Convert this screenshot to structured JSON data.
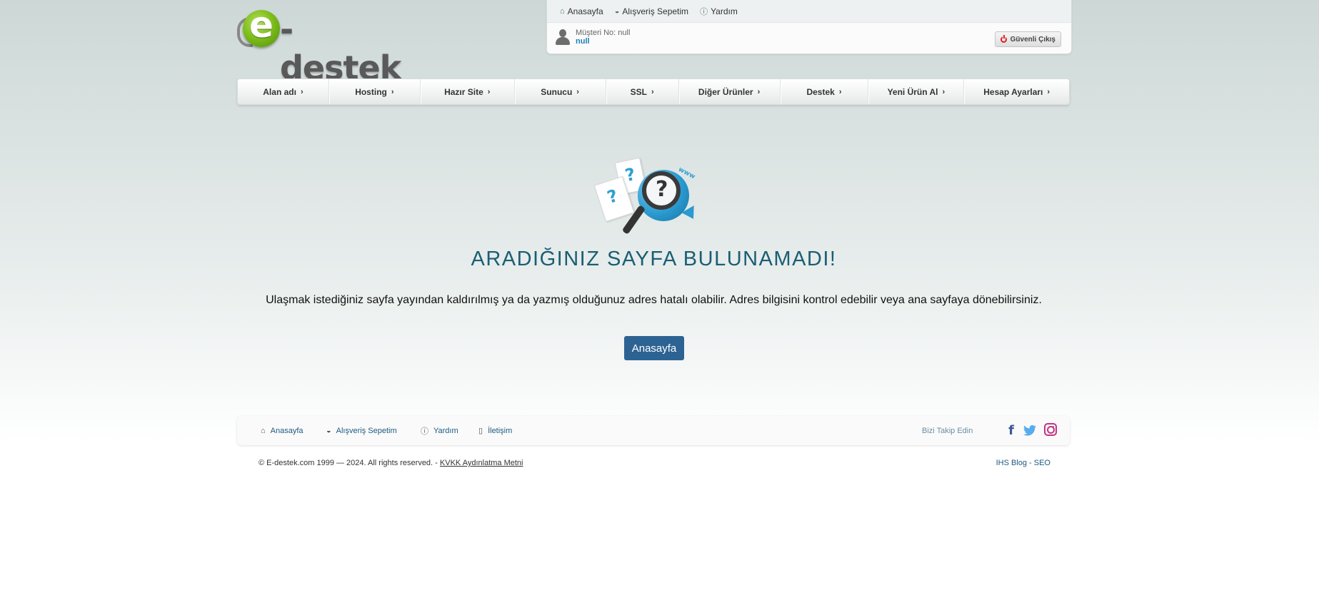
{
  "brand": {
    "logo_text": "e-destek"
  },
  "top_links": [
    {
      "label": "Anasayfa",
      "icon": "home-icon"
    },
    {
      "label": "Alışveriş Sepetim",
      "icon": "basket-icon"
    },
    {
      "label": "Yardım",
      "icon": "help-icon"
    }
  ],
  "customer": {
    "number_label": "Müşteri No: null",
    "name": "null"
  },
  "logout_label": "Güvenli Çıkış",
  "nav": [
    {
      "label": "Alan adı"
    },
    {
      "label": "Hosting"
    },
    {
      "label": "Hazır Site"
    },
    {
      "label": "Sunucu"
    },
    {
      "label": "SSL"
    },
    {
      "label": "Diğer Ürünler"
    },
    {
      "label": "Destek"
    },
    {
      "label": "Yeni Ürün Al"
    },
    {
      "label": "Hesap Ayarları"
    }
  ],
  "error": {
    "title": "ARADIĞINIZ SAYFA BULUNAMADI!",
    "message": "Ulaşmak istediğiniz sayfa yayından kaldırılmış ya da yazmış olduğunuz adres hatalı olabilir. Adres bilgisini kontrol edebilir veya ana sayfaya dönebilirsiniz.",
    "button": "Anasayfa",
    "illustration_text": "www"
  },
  "footer": {
    "links": [
      {
        "label": "Anasayfa",
        "icon": "home-icon"
      },
      {
        "label": "Alışveriş Sepetim",
        "icon": "basket-icon"
      },
      {
        "label": "Yardım",
        "icon": "help-icon"
      },
      {
        "label": "İletişim",
        "icon": "contact-icon"
      }
    ],
    "follow_label": "Bizi Takip Edin",
    "copyright": "© E-destek.com 1999 — 2024. All rights reserved. -",
    "kvkk_link": "KVKK Aydınlatma Metni",
    "blog_link": "IHS Blog - SEO"
  },
  "colors": {
    "title": "#1b5e73",
    "button": "#2d6393",
    "link": "#1d5a80"
  }
}
